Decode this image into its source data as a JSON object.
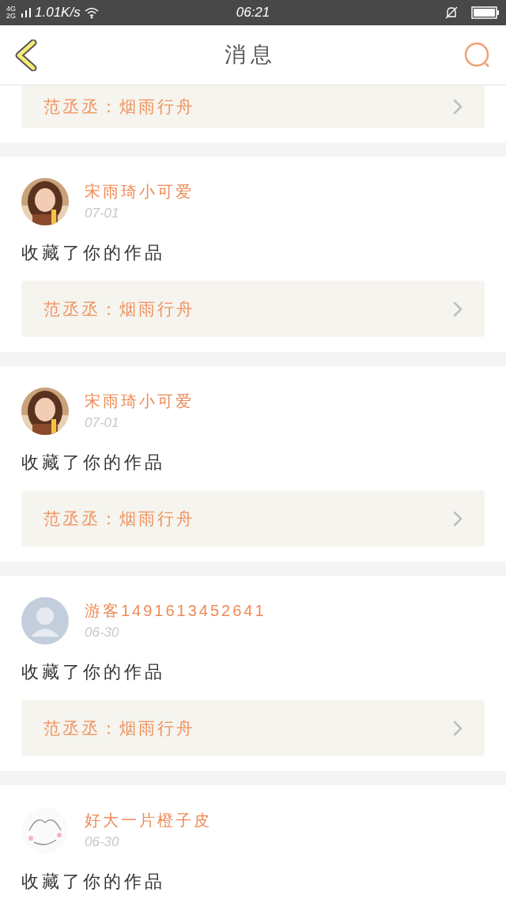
{
  "status_bar": {
    "network": "4G 2G",
    "speed": "1.01K/s",
    "time": "06:21"
  },
  "header": {
    "title": "消息"
  },
  "top_link": {
    "text": "范丞丞：烟雨行舟"
  },
  "messages": [
    {
      "name": "宋雨琦小可爱",
      "time": "07-01",
      "action": "收藏了你的作品",
      "link": "范丞丞：烟雨行舟"
    },
    {
      "name": "宋雨琦小可爱",
      "time": "07-01",
      "action": "收藏了你的作品",
      "link": "范丞丞：烟雨行舟"
    },
    {
      "avatar": {
        "kind": "default"
      },
      "name": "游客1491613452641",
      "time": "06-30",
      "action": "收藏了你的作品",
      "link": "范丞丞：烟雨行舟"
    },
    {
      "avatar": {
        "kind": "doodle"
      },
      "name": "好大一片橙子皮",
      "time": "06-30",
      "action": "收藏了你的作品"
    }
  ]
}
